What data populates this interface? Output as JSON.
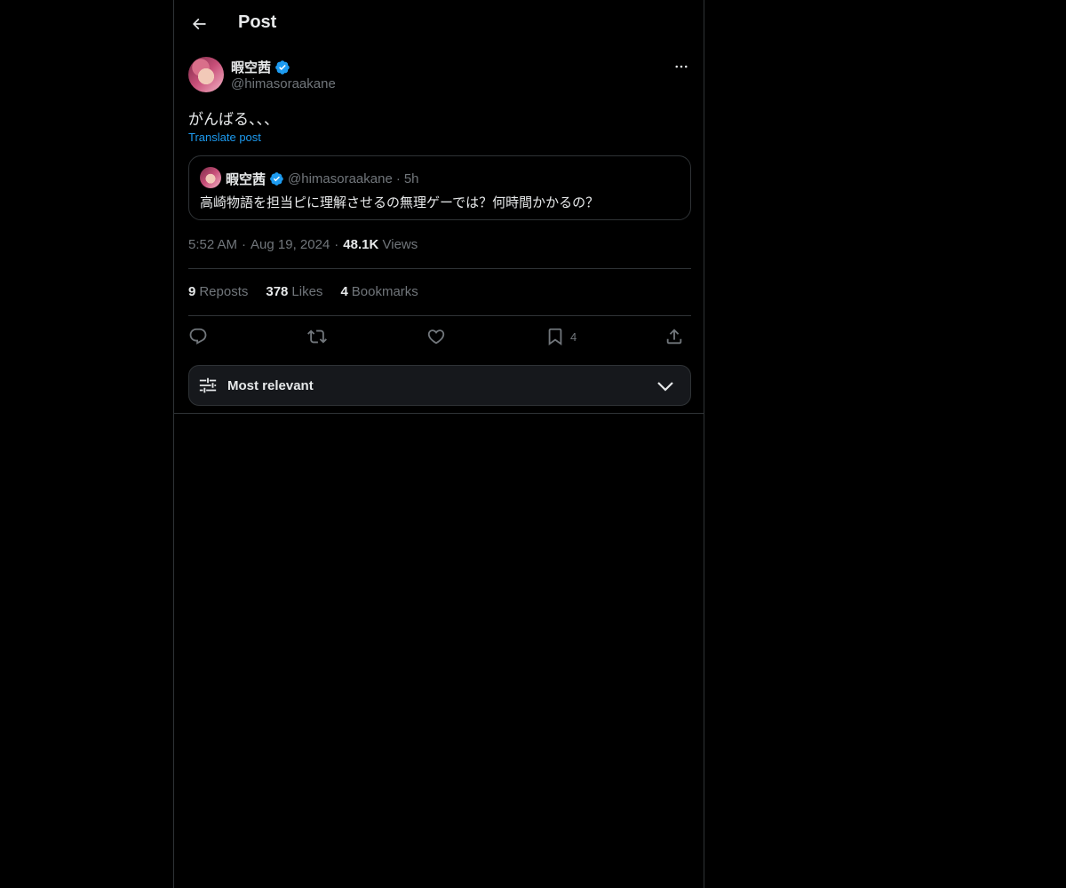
{
  "header": {
    "title": "Post"
  },
  "author": {
    "name": "暇空茜",
    "handle": "@himasoraakane"
  },
  "post": {
    "text": "がんばる、、、",
    "translate_label": "Translate post"
  },
  "quote": {
    "name": "暇空茜",
    "handle": "@himasoraakane",
    "separator": "·",
    "time": "5h",
    "text": "高崎物語を担当ピに理解させるの無理ゲーでは？何時間かかるの？"
  },
  "meta": {
    "time": "5:52 AM",
    "sep1": "·",
    "date": "Aug 19, 2024",
    "sep2": "·",
    "views_count": "48.1K",
    "views_label": "Views"
  },
  "stats": {
    "reposts_count": "9",
    "reposts_label": "Reposts",
    "likes_count": "378",
    "likes_label": "Likes",
    "bookmarks_count": "4",
    "bookmarks_label": "Bookmarks"
  },
  "actions": {
    "bookmark_count": "4"
  },
  "sort": {
    "label": "Most relevant"
  },
  "colors": {
    "background": "#000000",
    "border": "#2f3336",
    "accent": "#1d9bf0",
    "muted": "#71767b",
    "text": "#e7e9ea",
    "verified": "#1d9bf0"
  },
  "icons": [
    "back-arrow-icon",
    "verified-badge-icon",
    "more-icon",
    "reply-icon",
    "repost-icon",
    "like-icon",
    "bookmark-icon",
    "share-icon",
    "sliders-icon",
    "chevron-down-icon"
  ]
}
